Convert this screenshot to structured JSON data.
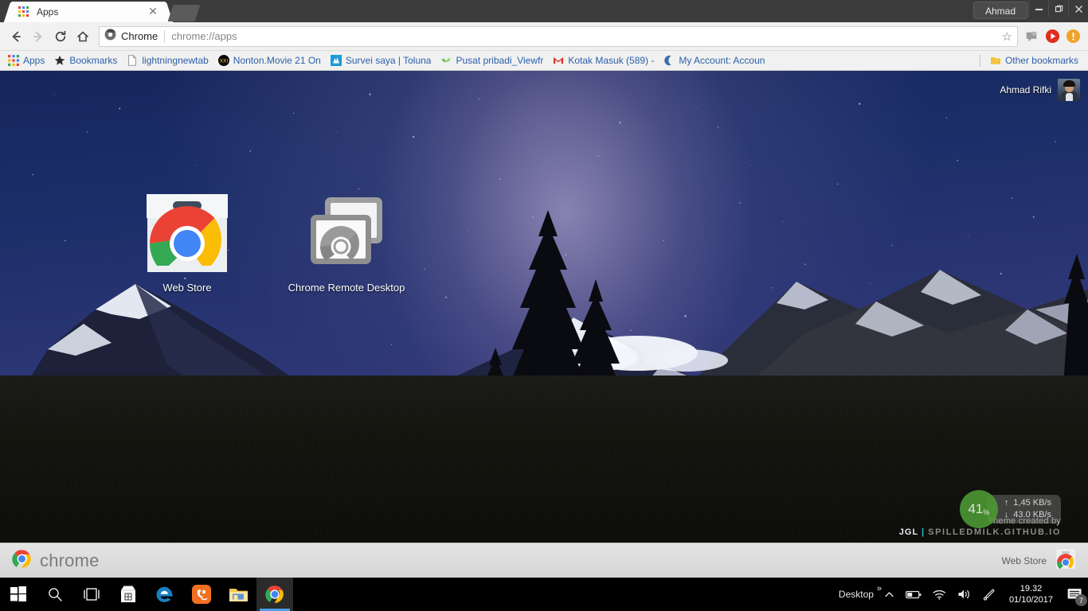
{
  "window": {
    "user_button": "Ahmad",
    "minimize": "—",
    "maximize": "❐",
    "close": "✕"
  },
  "tab": {
    "title": "Apps",
    "close": "✕",
    "favicon": "apps-grid-icon"
  },
  "toolbar": {
    "back": "←",
    "forward": "→",
    "reload": "⟳",
    "home": "⌂",
    "omnibox_chip": "Chrome",
    "omnibox_url": "chrome://apps",
    "star": "☆",
    "extensions": [
      "chat-bubble-icon",
      "youtube-play-icon",
      "chrome-menu-alert-icon"
    ]
  },
  "bookmarks": {
    "items": [
      {
        "label": "Apps",
        "icon": "apps-grid-icon"
      },
      {
        "label": "Bookmarks",
        "icon": "star-icon"
      },
      {
        "label": "lightningnewtab",
        "icon": "page-icon"
      },
      {
        "label": "Nonton.Movie 21 On",
        "icon": "xxi-icon"
      },
      {
        "label": "Survei saya | Toluna",
        "icon": "toluna-icon"
      },
      {
        "label": "Pusat pribadi_Viewfr",
        "icon": "leaf-icon"
      },
      {
        "label": "Kotak Masuk (589) -",
        "icon": "gmail-icon"
      },
      {
        "label": "My Account: Accoun",
        "icon": "moon-icon"
      }
    ],
    "other": {
      "label": "Other bookmarks",
      "icon": "folder-icon"
    }
  },
  "page": {
    "profile_name": "Ahmad Rifki",
    "apps": [
      {
        "label": "Web Store",
        "icon": "web-store-icon"
      },
      {
        "label": "Chrome Remote Desktop",
        "icon": "chrome-remote-desktop-icon"
      }
    ],
    "theme_credit": {
      "line1": "Theme created by",
      "author": "JGL",
      "separator": "|",
      "site": "SPILLEDMILK.GITHUB.IO"
    },
    "net_widget": {
      "cpu_value": "41",
      "cpu_unit": "%",
      "upload": "1,45 KB/s",
      "download": "43.0 KB/s",
      "up_arrow": "↑",
      "down_arrow": "↓"
    }
  },
  "footer": {
    "brand": "chrome",
    "web_store": "Web Store"
  },
  "taskbar": {
    "buttons": [
      {
        "name": "start",
        "icon": "windows-logo-icon"
      },
      {
        "name": "search",
        "icon": "search-icon"
      },
      {
        "name": "task-view",
        "icon": "task-view-icon"
      },
      {
        "name": "store",
        "icon": "microsoft-store-icon"
      },
      {
        "name": "edge",
        "icon": "edge-icon"
      },
      {
        "name": "uc-browser",
        "icon": "uc-browser-icon"
      },
      {
        "name": "file-explorer",
        "icon": "file-explorer-icon"
      },
      {
        "name": "chrome",
        "icon": "chrome-icon"
      }
    ],
    "tray": {
      "desktop_label": "Desktop",
      "overflow_chevron": "»",
      "show_hidden": "⌃",
      "battery": "battery-icon",
      "wifi": "wifi-icon",
      "volume": "volume-icon",
      "pen": "pen-icon",
      "time": "19.32",
      "date": "01/10/2017",
      "action_center_badge": "7"
    }
  },
  "colors": {
    "accent_blue": "#2b5faa",
    "chrome_green": "#4d9c33",
    "taskbar_black": "#000000",
    "titlebar": "#3b3b3b"
  }
}
